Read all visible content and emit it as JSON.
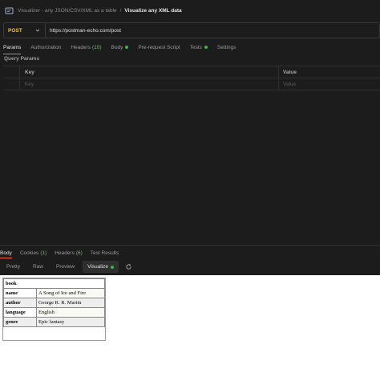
{
  "breadcrumb": {
    "parent": "Visualizer - any JSON/CSV/XML as a table",
    "separator": "/",
    "current": "Visualize any XML data"
  },
  "request": {
    "method": "POST",
    "url": "https://postman-echo.com/post"
  },
  "request_tabs": [
    {
      "label": "Params",
      "count": ""
    },
    {
      "label": "Authorization",
      "count": ""
    },
    {
      "label": "Headers",
      "count": "(10)"
    },
    {
      "label": "Body",
      "count": ""
    },
    {
      "label": "Pre-request Script",
      "count": ""
    },
    {
      "label": "Tests",
      "count": ""
    },
    {
      "label": "Settings",
      "count": ""
    }
  ],
  "query_params": {
    "title": "Query Params",
    "col_key": "Key",
    "col_value": "Value",
    "key_placeholder": "Key",
    "value_placeholder": "Value"
  },
  "response_tabs": [
    {
      "label": "Body",
      "count": ""
    },
    {
      "label": "Cookies",
      "count": "(1)"
    },
    {
      "label": "Headers",
      "count": "(6)"
    },
    {
      "label": "Test Results",
      "count": ""
    }
  ],
  "view_modes": [
    "Pretty",
    "Raw",
    "Preview",
    "Visualize"
  ],
  "visualization": {
    "root": "book",
    "rows": [
      {
        "key": "name",
        "value": "A Song of Ice and Fire"
      },
      {
        "key": "author",
        "value": "George R. R. Martin"
      },
      {
        "key": "language",
        "value": "English"
      },
      {
        "key": "genre",
        "value": "Epic fantasy"
      }
    ]
  },
  "colors": {
    "accent": "#ff6c37",
    "method": "#f1c232",
    "status_dot": "#3bb44a"
  }
}
